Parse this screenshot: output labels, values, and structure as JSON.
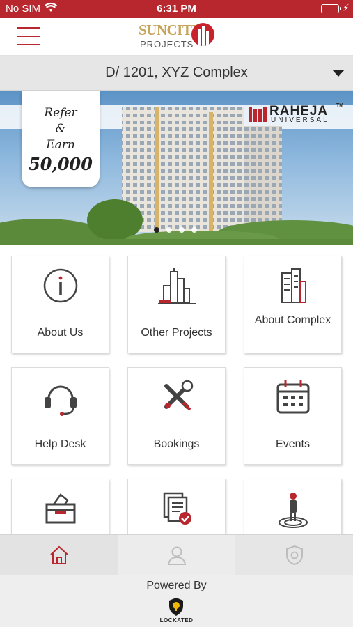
{
  "status_bar": {
    "carrier": "No SIM",
    "time": "6:31 PM",
    "battery_level": 1.0,
    "icons": [
      "wifi-icon",
      "battery-icon",
      "charging-bolt-icon"
    ]
  },
  "header": {
    "menu_icon": "hamburger-menu-icon",
    "logo": {
      "brand": "SUNCITY",
      "sub": "PROJECTS"
    }
  },
  "selector": {
    "value": "D/ 1201, XYZ Complex",
    "icon": "dropdown-arrow-icon"
  },
  "banner": {
    "refer_line1": "Refer",
    "refer_line2": "&",
    "refer_line3": "Earn",
    "refer_amount": "50,000",
    "brand_word1": "RAHEJA",
    "brand_word2": "UNIVERSAL",
    "brand_tm": "TM",
    "slide_count": 4,
    "active_slide": 1
  },
  "menu": {
    "tiles": [
      {
        "label": "About Us",
        "icon": "info-icon"
      },
      {
        "label": "Other Projects",
        "icon": "buildings-icon"
      },
      {
        "label": "About Complex",
        "icon": "complex-icon"
      },
      {
        "label": "Help Desk",
        "icon": "headset-icon"
      },
      {
        "label": "Bookings",
        "icon": "tools-icon"
      },
      {
        "label": "Events",
        "icon": "calendar-icon"
      },
      {
        "label": "",
        "icon": "ballot-box-icon"
      },
      {
        "label": "",
        "icon": "documents-check-icon"
      },
      {
        "label": "",
        "icon": "person-target-icon"
      }
    ]
  },
  "tabbar": {
    "tabs": [
      {
        "icon": "home-icon",
        "active": true
      },
      {
        "icon": "profile-icon",
        "active": false
      },
      {
        "icon": "shield-icon",
        "active": false
      }
    ]
  },
  "footer": {
    "powered_by": "Powered By",
    "logo_name": "LOCKATED"
  },
  "colors": {
    "accent": "#b8272e",
    "tab_bar": "#e3e3e3",
    "icon_gray": "#444444"
  }
}
